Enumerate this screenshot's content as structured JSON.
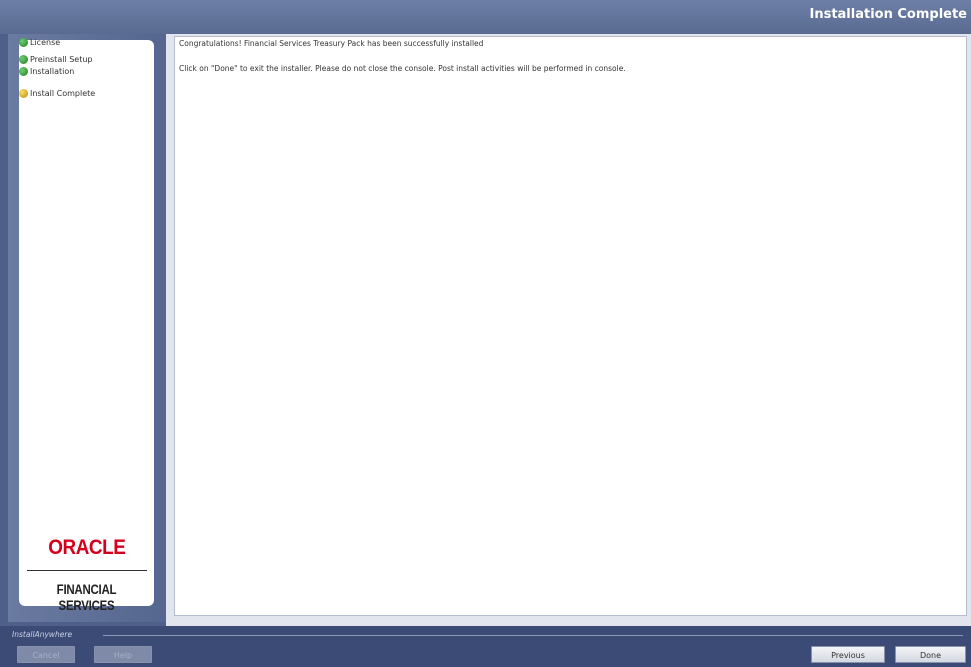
{
  "header": {
    "title": "Installation Complete"
  },
  "steps": [
    {
      "label": "License",
      "status": "done"
    },
    {
      "label": "Preinstall Setup",
      "status": "done"
    },
    {
      "label": "Installation",
      "status": "done"
    },
    {
      "label": "Install Complete",
      "status": "current"
    }
  ],
  "logo": {
    "brand": "ORACLE",
    "sub": "FINANCIAL SERVICES"
  },
  "content": {
    "line1": "Congratulations! Financial Services Treasury Pack has been successfully installed",
    "line2": "Click on \"Done\" to exit the installer. Please do not close the console. Post install activities will be performed in console."
  },
  "footer": {
    "brand": "InstallAnywhere",
    "cancel": "Cancel",
    "help": "Help",
    "previous": "Previous",
    "done": "Done"
  },
  "colors": {
    "header": "#5a6b92",
    "oracle_red": "#d4001c",
    "footer": "#3b4b75"
  }
}
